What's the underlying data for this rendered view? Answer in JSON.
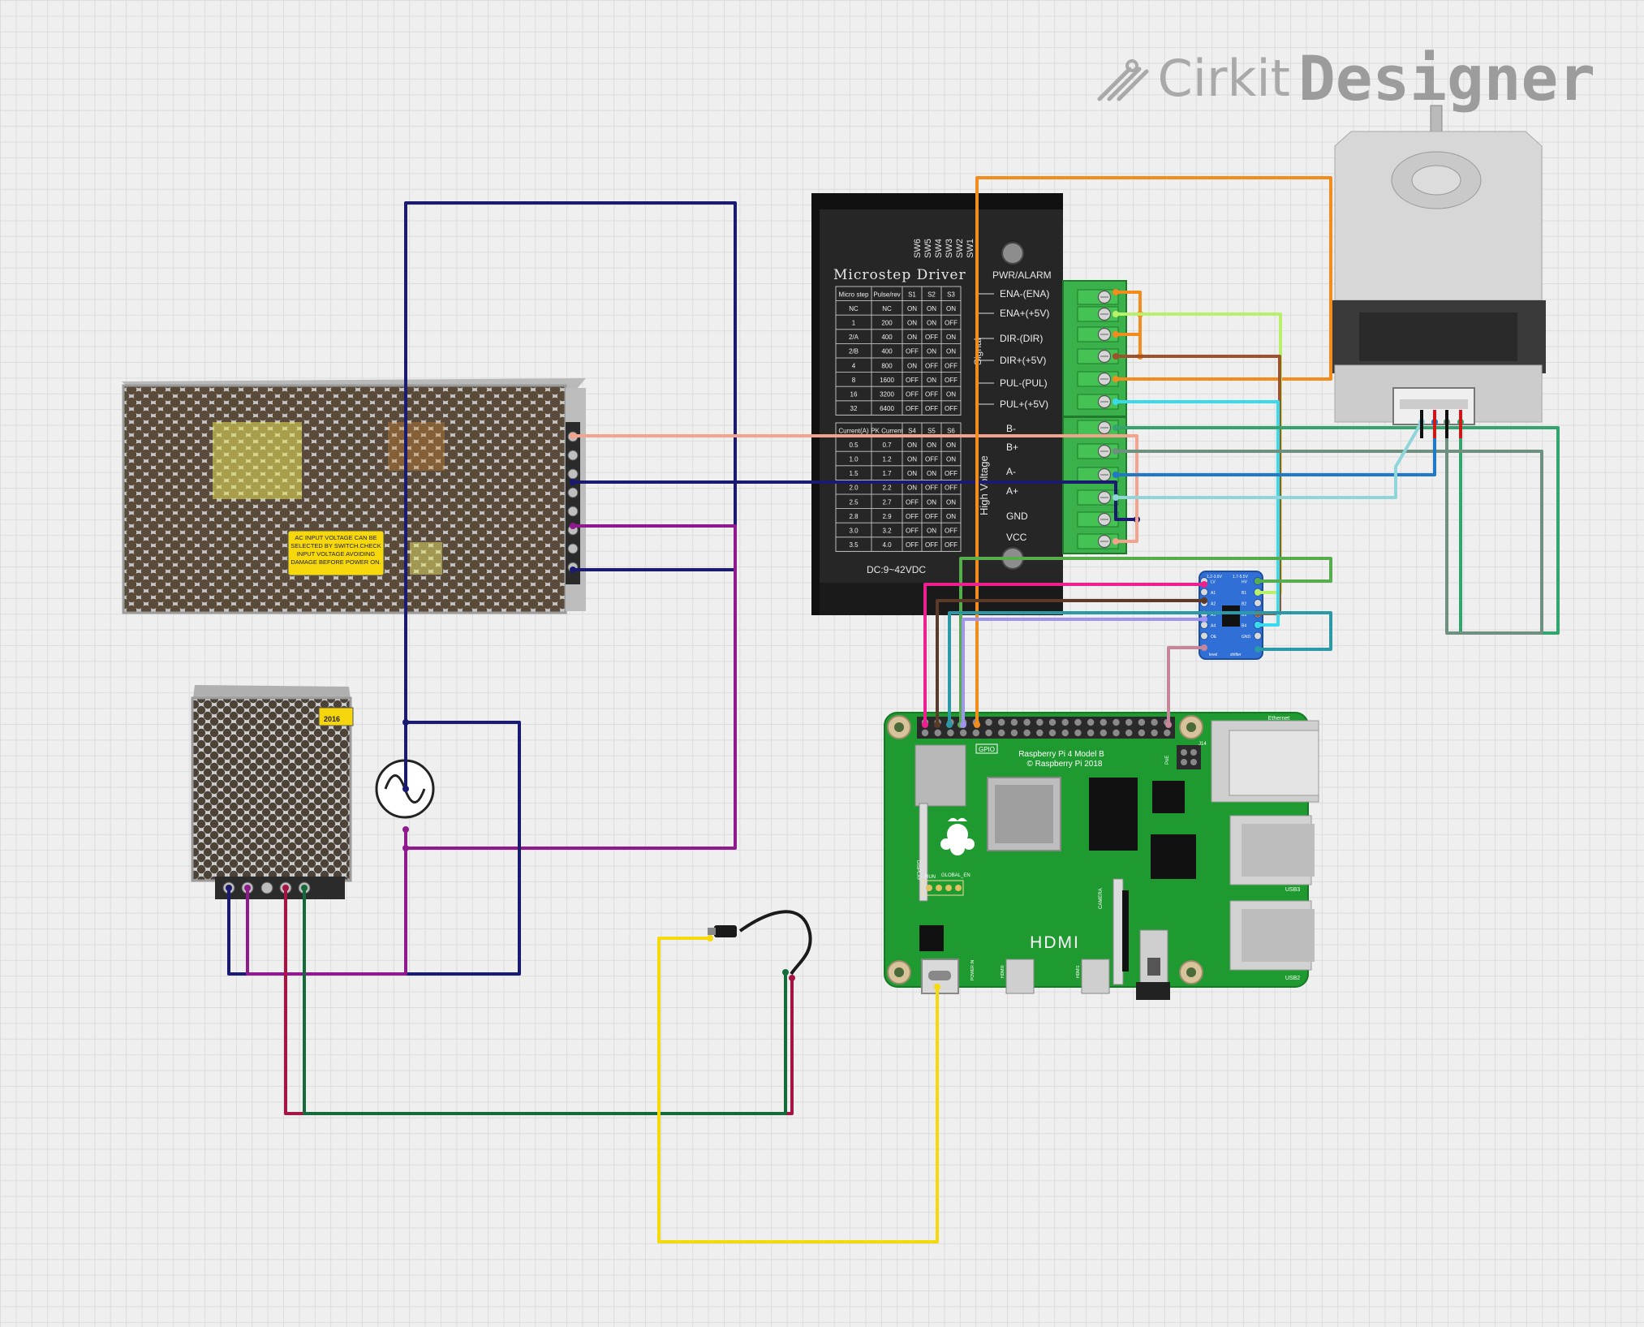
{
  "brand": {
    "name_left": "Cirkit",
    "name_right": "Designer"
  },
  "driver": {
    "title": "Microstep Driver",
    "switch_labels": [
      "SW6",
      "SW5",
      "SW4",
      "SW3",
      "SW2",
      "SW1"
    ],
    "pwr_alarm": "PWR/ALARM",
    "signal_label": "Signal",
    "hv_label": "High Voltage",
    "dc_label": "DC:9~42VDC",
    "signal_pins": [
      "ENA-(ENA)",
      "ENA+(+5V)",
      "DIR-(DIR)",
      "DIR+(+5V)",
      "PUL-(PUL)",
      "PUL+(+5V)"
    ],
    "power_pins": [
      "B-",
      "B+",
      "A-",
      "A+",
      "GND",
      "VCC"
    ],
    "step_table": {
      "headers": [
        "Micro step",
        "Pulse/rev",
        "S1",
        "S2",
        "S3"
      ],
      "rows": [
        [
          "NC",
          "NC",
          "ON",
          "ON",
          "ON"
        ],
        [
          "1",
          "200",
          "ON",
          "ON",
          "OFF"
        ],
        [
          "2/A",
          "400",
          "ON",
          "OFF",
          "ON"
        ],
        [
          "2/B",
          "400",
          "OFF",
          "ON",
          "ON"
        ],
        [
          "4",
          "800",
          "ON",
          "OFF",
          "OFF"
        ],
        [
          "8",
          "1600",
          "OFF",
          "ON",
          "OFF"
        ],
        [
          "16",
          "3200",
          "OFF",
          "OFF",
          "ON"
        ],
        [
          "32",
          "6400",
          "OFF",
          "OFF",
          "OFF"
        ]
      ]
    },
    "current_table": {
      "headers": [
        "Current(A)",
        "PK Current",
        "S4",
        "S5",
        "S6"
      ],
      "rows": [
        [
          "0.5",
          "0.7",
          "ON",
          "ON",
          "ON"
        ],
        [
          "1.0",
          "1.2",
          "ON",
          "OFF",
          "ON"
        ],
        [
          "1.5",
          "1.7",
          "ON",
          "ON",
          "OFF"
        ],
        [
          "2.0",
          "2.2",
          "ON",
          "OFF",
          "OFF"
        ],
        [
          "2.5",
          "2.7",
          "OFF",
          "ON",
          "ON"
        ],
        [
          "2.8",
          "2.9",
          "OFF",
          "OFF",
          "ON"
        ],
        [
          "3.0",
          "3.2",
          "OFF",
          "ON",
          "OFF"
        ],
        [
          "3.5",
          "4.0",
          "OFF",
          "OFF",
          "OFF"
        ]
      ]
    }
  },
  "psu_big": {
    "warning": [
      "AC INPUT VOLTAGE CAN BE",
      "SELECTED BY SWITCH.CHECK",
      "INPUT VOLTAGE AVOIDING",
      "DAMAGE BEFORE POWER ON."
    ]
  },
  "psu_small": {
    "label": "2016"
  },
  "level_shifter": {
    "top_left": "1.2-3.6V",
    "top_right": "1.7-5.5V",
    "left_pins": [
      "LV",
      "A1",
      "A2",
      "A3",
      "A4",
      "OE"
    ],
    "right_pins": [
      "HV",
      "B1",
      "B2",
      "B3",
      "B4",
      "GND"
    ],
    "bottom_left": "level",
    "bottom_right": "shifter"
  },
  "rpi": {
    "title": "Raspberry Pi 4 Model B",
    "copyright": "© Raspberry Pi 2018",
    "gpio": "GPIO",
    "ethernet": "Ethernet",
    "usb3": "USB3",
    "usb2": "USB2",
    "hdmi": "HDMI",
    "display": "DISPLAY",
    "camera": "CAMERA",
    "run": "RUN",
    "global_en": "GLOBAL_EN",
    "poe": "PoE",
    "j14": "J14",
    "power_in": "POWER IN",
    "hdmi0": "HDMI0",
    "hdmi1": "HDMI1"
  },
  "colors": {
    "navy": "#1a1a6e",
    "purple": "#8e1a8e",
    "salmon": "#f4a38c",
    "orange": "#f28c1c",
    "lime": "#b8f06a",
    "brown": "#a0522d",
    "cyan": "#39d9ee",
    "teal_green": "#34a46e",
    "blue": "#2079c8",
    "light_teal": "#8fd5d9",
    "grey_green": "#6f8f7f",
    "yellow": "#f5d90a",
    "maroon": "#a51442",
    "dark_green": "#136b3a",
    "pink": "#ee1f8e",
    "lavender": "#9f95f0",
    "sea": "#2c9aa6",
    "green_wire": "#57ad4e",
    "mauve": "#c6869a",
    "dark_brown": "#5b3a29",
    "board_green": "#1f9a30",
    "driver_black": "#1e1e1e",
    "terminal_green": "#3ab14a",
    "shifter_blue": "#2f6fd6"
  }
}
